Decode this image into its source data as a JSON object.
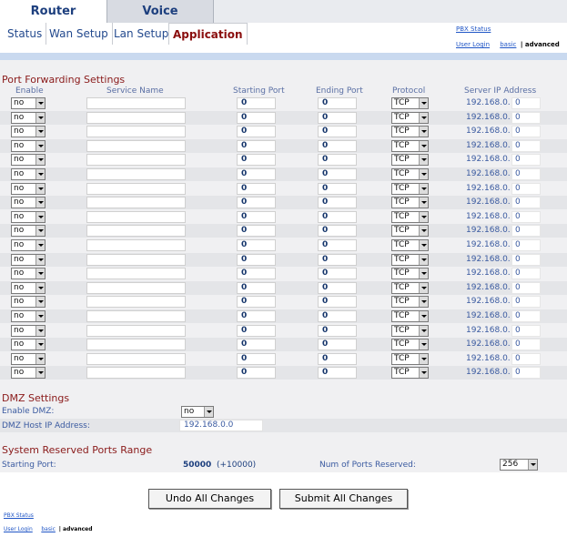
{
  "tabs": {
    "router": "Router",
    "voice": "Voice"
  },
  "subtabs": [
    "Status",
    "Wan Setup",
    "Lan Setup",
    "Application"
  ],
  "top_links": {
    "pbx_status": "PBX Status",
    "user_login": "User Login",
    "basic": "basic",
    "advanced": "| advanced"
  },
  "port_forwarding": {
    "title": "Port Forwarding Settings",
    "headers": {
      "enable": "Enable",
      "service": "Service Name",
      "start": "Starting Port",
      "end": "Ending Port",
      "protocol": "Protocol",
      "server_ip": "Server IP Address"
    },
    "rows": [
      {
        "enable": "no",
        "service": "",
        "start": "0",
        "end": "0",
        "protocol": "TCP",
        "ip_prefix": "192.168.0.",
        "ip_last": "0"
      },
      {
        "enable": "no",
        "service": "",
        "start": "0",
        "end": "0",
        "protocol": "TCP",
        "ip_prefix": "192.168.0.",
        "ip_last": "0"
      },
      {
        "enable": "no",
        "service": "",
        "start": "0",
        "end": "0",
        "protocol": "TCP",
        "ip_prefix": "192.168.0.",
        "ip_last": "0"
      },
      {
        "enable": "no",
        "service": "",
        "start": "0",
        "end": "0",
        "protocol": "TCP",
        "ip_prefix": "192.168.0.",
        "ip_last": "0"
      },
      {
        "enable": "no",
        "service": "",
        "start": "0",
        "end": "0",
        "protocol": "TCP",
        "ip_prefix": "192.168.0.",
        "ip_last": "0"
      },
      {
        "enable": "no",
        "service": "",
        "start": "0",
        "end": "0",
        "protocol": "TCP",
        "ip_prefix": "192.168.0.",
        "ip_last": "0"
      },
      {
        "enable": "no",
        "service": "",
        "start": "0",
        "end": "0",
        "protocol": "TCP",
        "ip_prefix": "192.168.0.",
        "ip_last": "0"
      },
      {
        "enable": "no",
        "service": "",
        "start": "0",
        "end": "0",
        "protocol": "TCP",
        "ip_prefix": "192.168.0.",
        "ip_last": "0"
      },
      {
        "enable": "no",
        "service": "",
        "start": "0",
        "end": "0",
        "protocol": "TCP",
        "ip_prefix": "192.168.0.",
        "ip_last": "0"
      },
      {
        "enable": "no",
        "service": "",
        "start": "0",
        "end": "0",
        "protocol": "TCP",
        "ip_prefix": "192.168.0.",
        "ip_last": "0"
      },
      {
        "enable": "no",
        "service": "",
        "start": "0",
        "end": "0",
        "protocol": "TCP",
        "ip_prefix": "192.168.0.",
        "ip_last": "0"
      },
      {
        "enable": "no",
        "service": "",
        "start": "0",
        "end": "0",
        "protocol": "TCP",
        "ip_prefix": "192.168.0.",
        "ip_last": "0"
      },
      {
        "enable": "no",
        "service": "",
        "start": "0",
        "end": "0",
        "protocol": "TCP",
        "ip_prefix": "192.168.0.",
        "ip_last": "0"
      },
      {
        "enable": "no",
        "service": "",
        "start": "0",
        "end": "0",
        "protocol": "TCP",
        "ip_prefix": "192.168.0.",
        "ip_last": "0"
      },
      {
        "enable": "no",
        "service": "",
        "start": "0",
        "end": "0",
        "protocol": "TCP",
        "ip_prefix": "192.168.0.",
        "ip_last": "0"
      },
      {
        "enable": "no",
        "service": "",
        "start": "0",
        "end": "0",
        "protocol": "TCP",
        "ip_prefix": "192.168.0.",
        "ip_last": "0"
      },
      {
        "enable": "no",
        "service": "",
        "start": "0",
        "end": "0",
        "protocol": "TCP",
        "ip_prefix": "192.168.0.",
        "ip_last": "0"
      },
      {
        "enable": "no",
        "service": "",
        "start": "0",
        "end": "0",
        "protocol": "TCP",
        "ip_prefix": "192.168.0.",
        "ip_last": "0"
      },
      {
        "enable": "no",
        "service": "",
        "start": "0",
        "end": "0",
        "protocol": "TCP",
        "ip_prefix": "192.168.0.",
        "ip_last": "0"
      },
      {
        "enable": "no",
        "service": "",
        "start": "0",
        "end": "0",
        "protocol": "TCP",
        "ip_prefix": "192.168.0.",
        "ip_last": "0"
      }
    ]
  },
  "dmz": {
    "title": "DMZ Settings",
    "enable_label": "Enable DMZ:",
    "enable_value": "no",
    "host_label": "DMZ Host IP Address:",
    "host_value": "192.168.0.0"
  },
  "reserved": {
    "title": "System Reserved Ports Range",
    "start_label": "Starting Port:",
    "start_value": "50000",
    "start_extra": "(+10000)",
    "num_label": "Num of Ports Reserved:",
    "num_value": "256"
  },
  "buttons": {
    "undo": "Undo All Changes",
    "submit": "Submit All Changes"
  },
  "bottom_links": {
    "pbx_status": "PBX Status",
    "user_login": "User Login",
    "basic": "basic",
    "advanced": "| advanced"
  }
}
